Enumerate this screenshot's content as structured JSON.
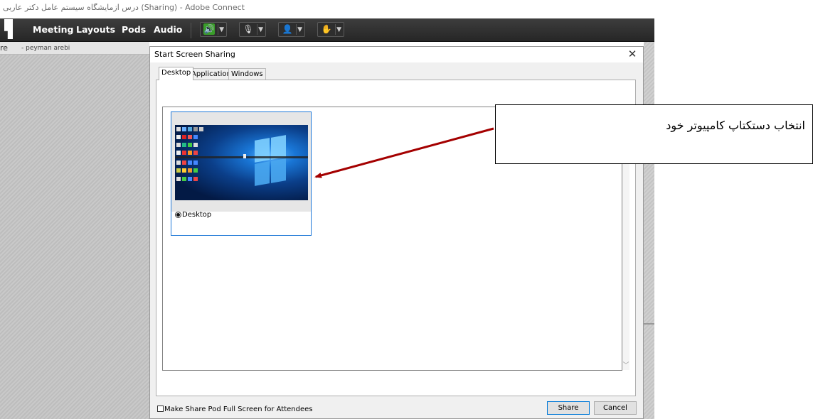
{
  "window": {
    "title": "درس ازمایشگاه سیستم عامل دکتر عاربی (Sharing) - Adobe Connect"
  },
  "menubar": {
    "items": [
      "Meeting",
      "Layouts",
      "Pods",
      "Audio"
    ],
    "buttons": [
      {
        "name": "speaker",
        "glyph": "🔊",
        "color": "#3a9d2a"
      },
      {
        "name": "microphone",
        "glyph": "🎙"
      },
      {
        "name": "camera",
        "glyph": "👤"
      },
      {
        "name": "status",
        "glyph": "✋"
      }
    ]
  },
  "share_pod": {
    "label": "re",
    "user": "- peyman arebi"
  },
  "dialog": {
    "title": "Start Screen Sharing",
    "close": "✕",
    "tabs": [
      "Desktop",
      "Applications",
      "Windows"
    ],
    "active_tab": "Desktop",
    "options": [
      {
        "label": "Desktop",
        "selected": true
      }
    ],
    "fullscreen_label": "Make Share Pod Full Screen for Attendees",
    "fullscreen_checked": false,
    "share_label": "Share",
    "cancel_label": "Cancel",
    "accent": "#1e78d7"
  },
  "callout": {
    "text": "انتخاب دستکتاپ کامپیوتر خود",
    "arrow_color": "#a40000"
  }
}
